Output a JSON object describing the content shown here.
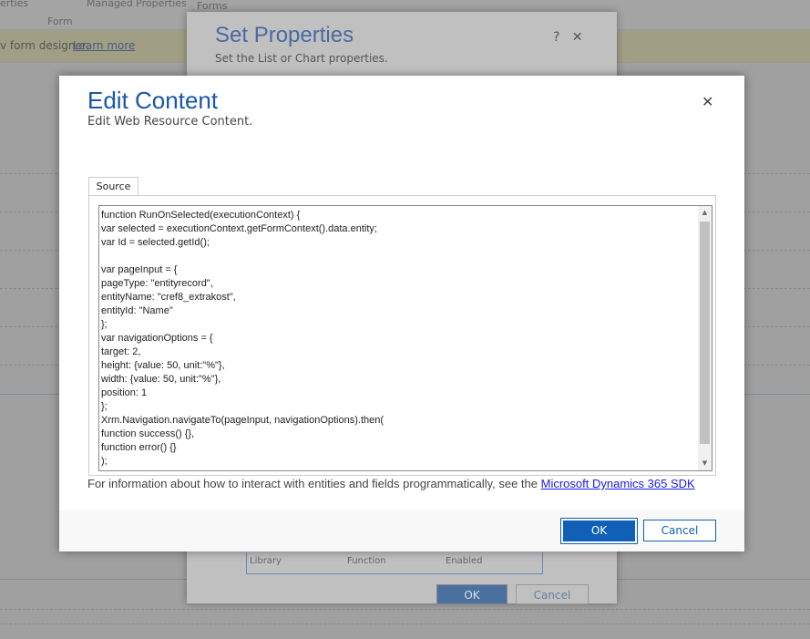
{
  "ribbon": {
    "item1": "erties",
    "managed_properties": "Managed Properties",
    "forms": "Forms",
    "group": "Form"
  },
  "banner": {
    "text": "v form designer.",
    "link": "Learn more"
  },
  "set_properties": {
    "title": "Set Properties",
    "subtitle": "Set the List or Chart properties.",
    "help": "?",
    "close": "✕",
    "grid_columns": [
      "Library",
      "Function",
      "Enabled"
    ],
    "ok": "OK",
    "cancel": "Cancel"
  },
  "edit_content": {
    "title": "Edit Content",
    "subtitle": "Edit Web Resource Content.",
    "close": "✕",
    "tab": "Source",
    "code": "function RunOnSelected(executionContext) {\nvar selected = executionContext.getFormContext().data.entity;\nvar Id = selected.getId();\n\nvar pageInput = {\npageType: \"entityrecord\",\nentityName: \"cref8_extrakost\",\nentityId: \"Name\"\n};\nvar navigationOptions = {\ntarget: 2,\nheight: {value: 50, unit:\"%\"},\nwidth: {value: 50, unit:\"%\"},\nposition: 1\n};\nXrm.Navigation.navigateTo(pageInput, navigationOptions).then(\nfunction success() {},\nfunction error() {}\n);",
    "info_text": "For information about how to interact with entities and fields programmatically, see the ",
    "info_link": "Microsoft Dynamics 365 SDK",
    "ok": "OK",
    "cancel": "Cancel"
  }
}
